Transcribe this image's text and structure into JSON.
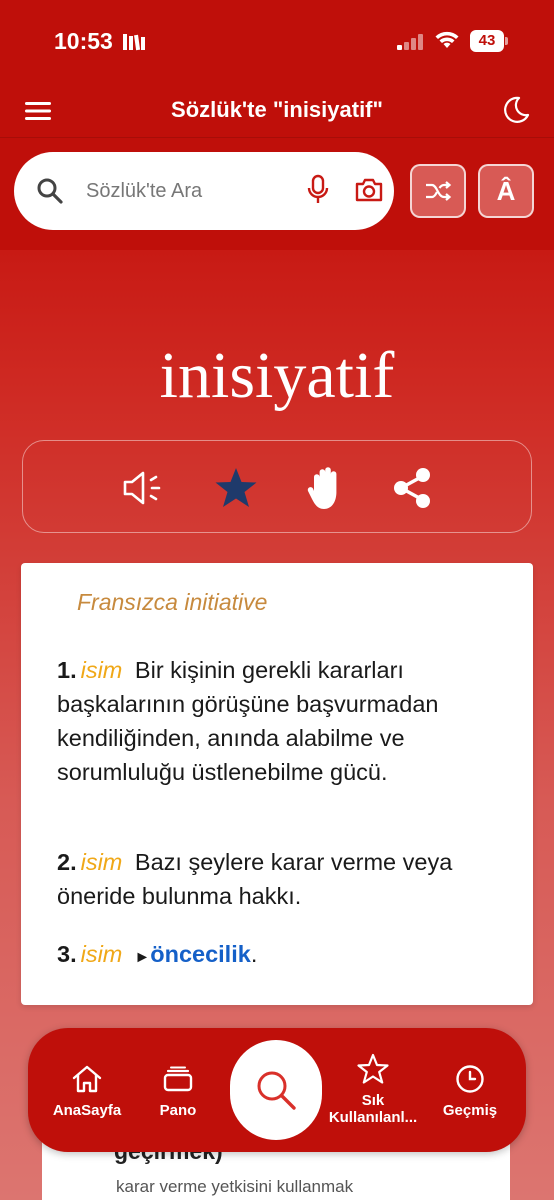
{
  "status": {
    "time": "10:53",
    "battery": "43"
  },
  "header": {
    "title": "Sözlük'te \"inisiyatif\""
  },
  "search": {
    "placeholder": "Sözlük'te Ara",
    "accent_label": "Â"
  },
  "word": {
    "title": "inisiyatif"
  },
  "entry": {
    "origin": "Fransızca initiative",
    "definitions": [
      {
        "num": "1.",
        "pos": "isim",
        "text": "Bir kişinin gerekli kararları başkalarının görüşüne başvurmadan kendiliğinden, anında alabilme ve sorumluluğu üstlenebilme gücü."
      },
      {
        "num": "2.",
        "pos": "isim",
        "text": "Bazı şeylere karar verme veya öneride bulunma hakkı."
      },
      {
        "num": "3.",
        "pos": "isim",
        "ref": "öncecilik",
        "ref_suffix": "."
      }
    ]
  },
  "next_card": {
    "partial_title": "geçirmek)",
    "text": "karar verme yetkisini kullanmak"
  },
  "nav": {
    "home": "AnaSayfa",
    "pano": "Pano",
    "favorites": "Sık Kullanılanl...",
    "history": "Geçmiş"
  },
  "colors": {
    "primary": "#bf0f0a",
    "pos": "#f0a818",
    "origin": "#c78a3e",
    "link": "#1560c8",
    "star": "#1f3a6b"
  }
}
